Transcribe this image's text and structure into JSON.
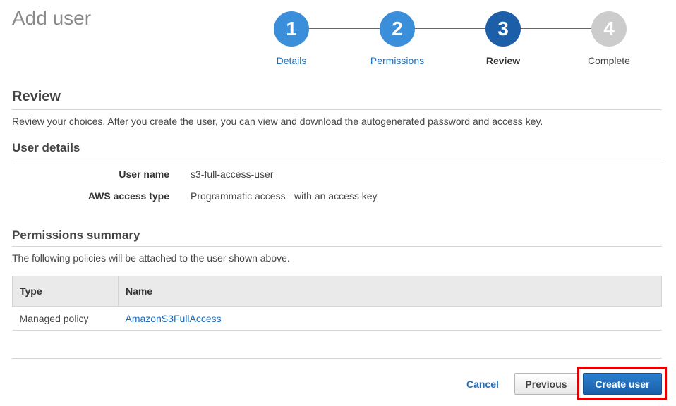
{
  "page": {
    "title": "Add user"
  },
  "wizard": {
    "steps": [
      {
        "number": "1",
        "label": "Details",
        "state": "done"
      },
      {
        "number": "2",
        "label": "Permissions",
        "state": "done"
      },
      {
        "number": "3",
        "label": "Review",
        "state": "current"
      },
      {
        "number": "4",
        "label": "Complete",
        "state": "todo"
      }
    ]
  },
  "review": {
    "title": "Review",
    "description": "Review your choices. After you create the user, you can view and download the autogenerated password and access key."
  },
  "user_details": {
    "title": "User details",
    "rows": [
      {
        "label": "User name",
        "value": "s3-full-access-user"
      },
      {
        "label": "AWS access type",
        "value": "Programmatic access - with an access key"
      }
    ]
  },
  "permissions_summary": {
    "title": "Permissions summary",
    "description": "The following policies will be attached to the user shown above.",
    "columns": [
      "Type",
      "Name"
    ],
    "rows": [
      {
        "type": "Managed policy",
        "name": "AmazonS3FullAccess"
      }
    ]
  },
  "footer": {
    "cancel_label": "Cancel",
    "previous_label": "Previous",
    "create_label": "Create user"
  },
  "colors": {
    "step_done": "#3b8ed9",
    "step_current": "#1c5fa8",
    "step_todo": "#cccccc",
    "link": "#1f6db8",
    "primary_button": "#1a5fa8",
    "highlight": "#e00000"
  }
}
